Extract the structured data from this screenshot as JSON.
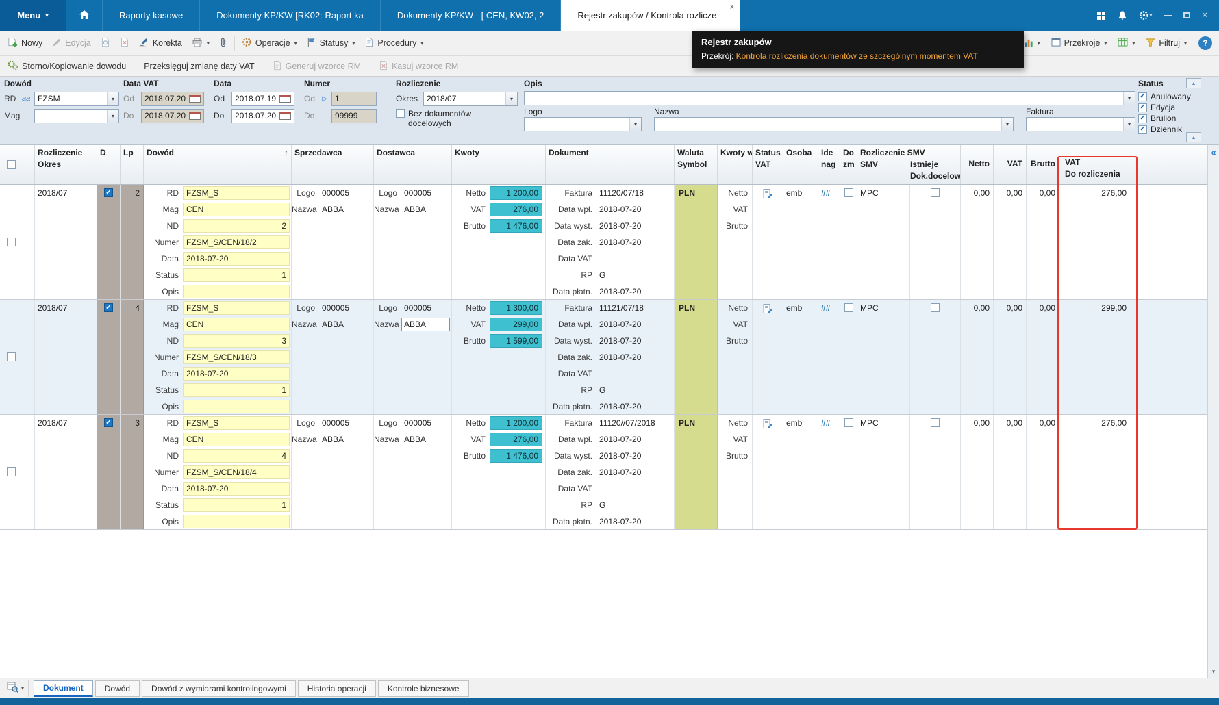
{
  "window": {
    "menu_label": "Menu",
    "tabs": [
      {
        "label": "Raporty kasowe"
      },
      {
        "label": "Dokumenty KP/KW [RK02: Raport ka"
      },
      {
        "label": "Dokumenty KP/KW - [ CEN, KW02, 2"
      },
      {
        "label": "Rejestr zakupów / Kontrola rozlicze"
      }
    ]
  },
  "icons": {
    "dropdown": "▾",
    "sort_asc": "↑",
    "collapse_up": "▴",
    "chevrons_left": "«",
    "scroll_down": "▾",
    "help": "?",
    "close": "×",
    "range": "▷"
  },
  "colors": {
    "topbar": "#0f70ad",
    "amount_highlight": "#3fc0d1",
    "editable_yellow": "#ffffc5",
    "currency_olive": "#d6dc8d",
    "highlight_red": "#e8372c"
  },
  "toolbar": {
    "nowy": "Nowy",
    "edycja": "Edycja",
    "korekta": "Korekta",
    "operacje": "Operacje",
    "statusy": "Statusy",
    "procedury": "Procedury",
    "przekroje": "Przekroje",
    "filtruj": "Filtruj"
  },
  "toolbar2": {
    "storno": "Storno/Kopiowanie dowodu",
    "przeksieguj": "Przeksięguj zmianę daty VAT",
    "generuj": "Generuj wzorce RM",
    "kasuj": "Kasuj wzorce RM"
  },
  "tooltip": {
    "title": "Rejestr zakupów",
    "prefix": "Przekrój:",
    "text": " Kontrola rozliczenia dokumentów ze szczególnym momentem VAT"
  },
  "filters": {
    "dowod_title": "Dowód",
    "rd_label": "RD",
    "rd_value": "FZSM",
    "mag_label": "Mag",
    "mag_value": "",
    "data_vat_title": "Data VAT",
    "od_label": "Od",
    "do_label": "Do",
    "data_vat_od": "2018.07.20",
    "data_vat_do": "2018.07.20",
    "data_title": "Data",
    "data_od": "2018.07.19",
    "data_do": "2018.07.20",
    "numer_title": "Numer",
    "numer_od": "1",
    "numer_do": "99999",
    "rozliczenie_title": "Rozliczenie",
    "okres_label": "Okres",
    "okres_value": "2018/07",
    "bez_dokumentow_label": "Bez dokumentów docelowych",
    "opis_title": "Opis",
    "opis_value": "",
    "logo_label": "Logo",
    "nazwa_label": "Nazwa",
    "faktura_label": "Faktura",
    "status_title": "Status",
    "status_options": [
      {
        "label": "Anulowany",
        "checked": true
      },
      {
        "label": "Edycja",
        "checked": true
      },
      {
        "label": "Brulion",
        "checked": true
      },
      {
        "label": "Dziennik",
        "checked": true
      }
    ]
  },
  "grid": {
    "header": {
      "rozliczenie": "Rozliczenie",
      "okres": "Okres",
      "d": "D",
      "lp": "Lp",
      "dowod": "Dowód",
      "sprzedawca": "Sprzedawca",
      "dostawca": "Dostawca",
      "kwoty": "Kwoty",
      "dokument": "Dokument",
      "waluta": "Waluta",
      "symbol": "Symbol",
      "kwoty_w": "Kwoty w",
      "status": "Status",
      "vat": "VAT",
      "osoba": "Osoba",
      "ide": "Ide",
      "nag": "nag",
      "do": "Do",
      "zm": "zm",
      "rozliczenie_smv": "Rozliczenie SMV",
      "smv": "SMV",
      "istnieje": "Istnieje",
      "dok_docelowy": "Dok.docelowy",
      "netto": "Netto",
      "vat2": "VAT",
      "brutto": "Brutto",
      "vat_dr1": "VAT",
      "vat_dr2": "Do rozliczenia"
    },
    "row_labels": {
      "rd": "RD",
      "mag": "Mag",
      "nd": "ND",
      "numer": "Numer",
      "data": "Data",
      "status": "Status",
      "opis": "Opis",
      "logo": "Logo",
      "nazwa": "Nazwa",
      "netto": "Netto",
      "vat": "VAT",
      "brutto": "Brutto",
      "faktura": "Faktura",
      "data_wpl": "Data wpł.",
      "data_wyst": "Data wyst.",
      "data_zak": "Data zak.",
      "data_vat": "Data VAT",
      "rp": "RP",
      "data_platn": "Data płatn."
    },
    "rows": [
      {
        "okres": "2018/07",
        "d_checked": true,
        "lp": "2",
        "rd": "FZSM_S",
        "mag": "CEN",
        "nd": "2",
        "numer": "FZSM_S/CEN/18/2",
        "data": "2018-07-20",
        "status": "1",
        "opis": "",
        "sp_logo": "000005",
        "sp_nazwa": "ABBA",
        "do_logo": "000005",
        "do_nazwa": "ABBA",
        "netto": "1 200,00",
        "vat": "276,00",
        "brutto": "1 476,00",
        "faktura": "11120/07/18",
        "data_wpl": "2018-07-20",
        "data_wyst": "2018-07-20",
        "data_zak": "2018-07-20",
        "data_vat": "",
        "rp": "G",
        "data_platn": "2018-07-20",
        "waluta": "PLN",
        "osoba": "emb",
        "ide": "##",
        "smv": "MPC",
        "netto2": "0,00",
        "vat2": "0,00",
        "brutto2": "0,00",
        "vat_do_rozliczenia": "276,00"
      },
      {
        "okres": "2018/07",
        "d_checked": true,
        "lp": "4",
        "rd": "FZSM_S",
        "mag": "CEN",
        "nd": "3",
        "numer": "FZSM_S/CEN/18/3",
        "data": "2018-07-20",
        "status": "1",
        "opis": "",
        "sp_logo": "000005",
        "sp_nazwa": "ABBA",
        "do_logo": "000005",
        "do_nazwa": "ABBA",
        "do_nazwa_boxed": true,
        "netto": "1 300,00",
        "vat": "299,00",
        "brutto": "1 599,00",
        "faktura": "11121/07/18",
        "data_wpl": "2018-07-20",
        "data_wyst": "2018-07-20",
        "data_zak": "2018-07-20",
        "data_vat": "",
        "rp": "G",
        "data_platn": "2018-07-20",
        "waluta": "PLN",
        "osoba": "emb",
        "ide": "##",
        "smv": "MPC",
        "netto2": "0,00",
        "vat2": "0,00",
        "brutto2": "0,00",
        "vat_do_rozliczenia": "299,00"
      },
      {
        "okres": "2018/07",
        "d_checked": true,
        "lp": "3",
        "rd": "FZSM_S",
        "mag": "CEN",
        "nd": "4",
        "numer": "FZSM_S/CEN/18/4",
        "data": "2018-07-20",
        "status": "1",
        "opis": "",
        "sp_logo": "000005",
        "sp_nazwa": "ABBA",
        "do_logo": "000005",
        "do_nazwa": "ABBA",
        "netto": "1 200,00",
        "vat": "276,00",
        "brutto": "1 476,00",
        "faktura": "11120//07/2018",
        "data_wpl": "2018-07-20",
        "data_wyst": "2018-07-20",
        "data_zak": "2018-07-20",
        "data_vat": "",
        "rp": "G",
        "data_platn": "2018-07-20",
        "waluta": "PLN",
        "osoba": "emb",
        "ide": "##",
        "smv": "MPC",
        "netto2": "0,00",
        "vat2": "0,00",
        "brutto2": "0,00",
        "vat_do_rozliczenia": "276,00"
      }
    ]
  },
  "bottom_tabs": [
    {
      "label": "Dokument",
      "active": true
    },
    {
      "label": "Dowód",
      "active": false
    },
    {
      "label": "Dowód z wymiarami kontrolingowymi",
      "active": false
    },
    {
      "label": "Historia operacji",
      "active": false
    },
    {
      "label": "Kontrole biznesowe",
      "active": false
    }
  ]
}
